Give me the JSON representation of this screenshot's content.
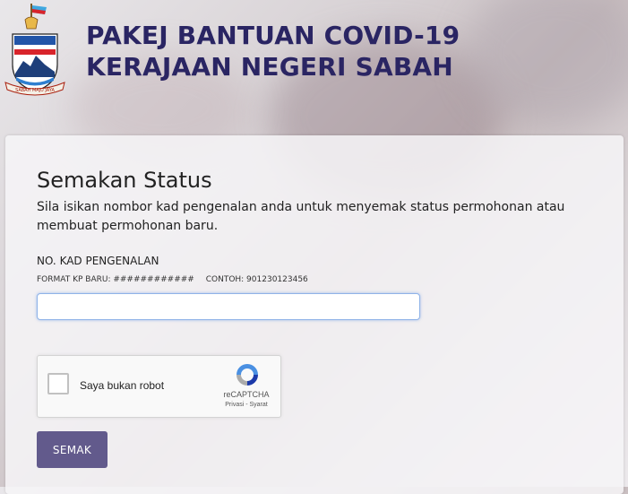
{
  "header": {
    "title_line1": "PAKEJ BANTUAN COVID-19",
    "title_line2": "KERAJAAN NEGERI SABAH",
    "logo_text": "SABAH MAJU JAYA"
  },
  "form": {
    "heading": "Semakan Status",
    "description": "Sila isikan nombor kad pengenalan anda untuk menyemak status permohonan atau membuat permohonan baru.",
    "ic_label": "NO. KAD PENGENALAN",
    "format_hint": "FORMAT KP BARU: ############",
    "example_hint": "CONTOH: 901230123456",
    "ic_value": "",
    "submit_label": "SEMAK"
  },
  "captcha": {
    "label": "Saya bukan robot",
    "brand": "reCAPTCHA",
    "links": "Privasi - Syarat",
    "icon": "recaptcha-logo"
  },
  "colors": {
    "title": "#2a2563",
    "button": "#625a8c",
    "input_focus": "#8fb3e8"
  }
}
